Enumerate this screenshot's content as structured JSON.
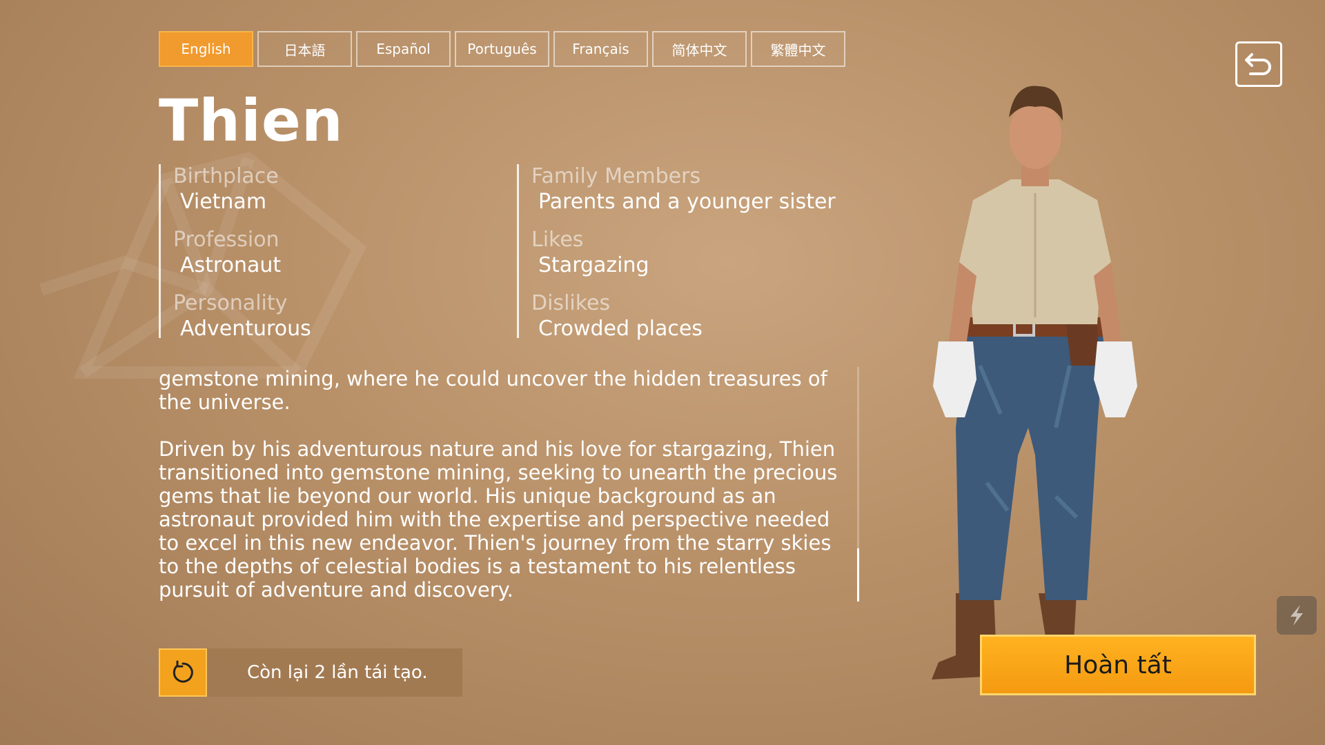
{
  "languages": {
    "items": [
      "English",
      "日本語",
      "Español",
      "Português",
      "Français",
      "简体中文",
      "繁體中文"
    ],
    "active": "English"
  },
  "character": {
    "name": "Thien"
  },
  "attributes": {
    "left": [
      {
        "label": "Birthplace",
        "value": "Vietnam"
      },
      {
        "label": "Profession",
        "value": "Astronaut"
      },
      {
        "label": "Personality",
        "value": "Adventurous"
      }
    ],
    "right": [
      {
        "label": "Family Members",
        "value": "Parents and a younger sister"
      },
      {
        "label": "Likes",
        "value": "Stargazing"
      },
      {
        "label": "Dislikes",
        "value": "Crowded places"
      }
    ]
  },
  "bio": {
    "p1": "gemstone mining, where he could uncover the hidden treasures of the universe.",
    "p2": "Driven by his adventurous nature and his love for stargazing, Thien transitioned into gemstone mining, seeking to unearth the precious gems that lie beyond our world. His unique background as an astronaut provided him with the expertise and perspective needed to excel in this new endeavor. Thien's journey from the starry skies to the depths of celestial bodies is a testament to his relentless pursuit of adventure and discovery."
  },
  "regenerate": {
    "text": "Còn lại 2 lần tái tạo."
  },
  "complete": {
    "label": "Hoàn tất"
  },
  "icons": {
    "back": "back-arrow-icon",
    "regenerate": "refresh-icon",
    "side": "lightning-icon"
  },
  "colors": {
    "accent": "#f3a21e",
    "background": "#b89068"
  }
}
